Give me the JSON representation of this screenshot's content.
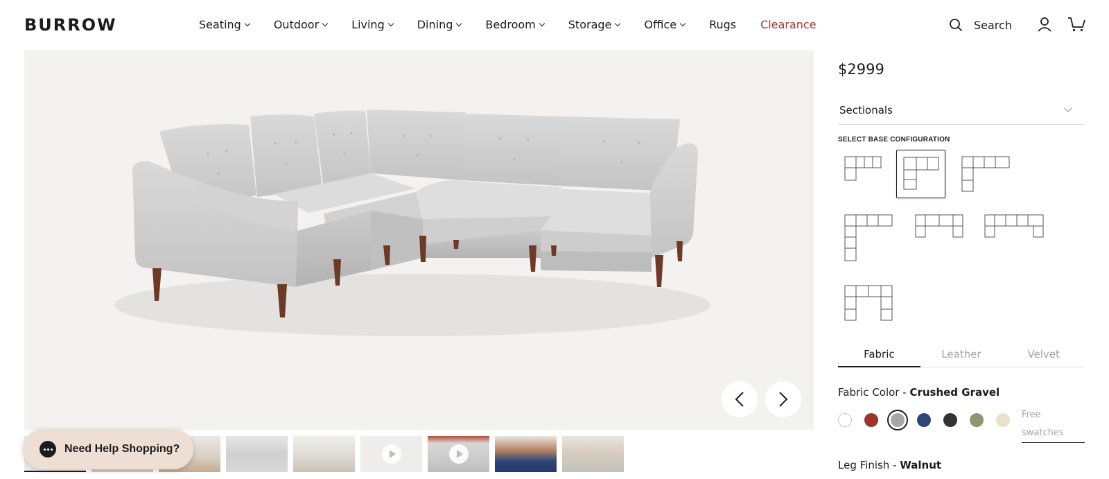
{
  "brand": {
    "logo_text": "BURROW"
  },
  "nav": {
    "items": [
      {
        "label": "Seating",
        "dropdown": true
      },
      {
        "label": "Outdoor",
        "dropdown": true
      },
      {
        "label": "Living",
        "dropdown": true
      },
      {
        "label": "Dining",
        "dropdown": true
      },
      {
        "label": "Bedroom",
        "dropdown": true
      },
      {
        "label": "Storage",
        "dropdown": true
      },
      {
        "label": "Office",
        "dropdown": true
      },
      {
        "label": "Rugs",
        "dropdown": false
      },
      {
        "label": "Clearance",
        "dropdown": false
      }
    ],
    "clearance_color": "#a0372d"
  },
  "header": {
    "search_label": "Search",
    "icons": [
      "search-icon",
      "account-icon",
      "cart-icon"
    ]
  },
  "gallery": {
    "prev_icon": "chevron-left-icon",
    "next_icon": "chevron-right-icon",
    "thumbnails_count": 9,
    "video_thumbnails": [
      6,
      7
    ]
  },
  "help": {
    "label": "Need Help Shopping?"
  },
  "product": {
    "price": "$2999",
    "category": "Sectionals",
    "config_heading": "SELECT BASE CONFIGURATION",
    "selected_config": 2,
    "config_count": 7,
    "material_tabs": [
      {
        "label": "Fabric",
        "active": true
      },
      {
        "label": "Leather",
        "active": false
      },
      {
        "label": "Velvet",
        "active": false
      }
    ],
    "fabric_color_label": "Fabric Color - ",
    "fabric_color_value": "Crushed Gravel",
    "swatches": [
      {
        "color": "#ffffff",
        "selected": false
      },
      {
        "color": "#9b342b",
        "selected": false
      },
      {
        "color": "#a7a7a7",
        "selected": true
      },
      {
        "color": "#2e4779",
        "selected": false
      },
      {
        "color": "#323232",
        "selected": false
      },
      {
        "color": "#8c9670",
        "selected": false
      },
      {
        "color": "#e8e1cc",
        "selected": false
      }
    ],
    "free_swatches_label": "Free swatches",
    "leg_finish_label": "Leg Finish - ",
    "leg_finish_value": "Walnut"
  }
}
